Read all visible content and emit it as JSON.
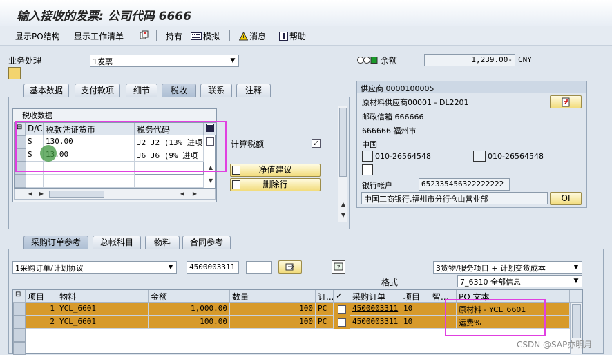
{
  "window": {
    "title": "输入接收的发票: 公司代码 6666"
  },
  "toolbar": {
    "show_po_structure": "显示PO结构",
    "show_worklist": "显示工作清单",
    "hold": "持有",
    "simulate": "模拟",
    "messages": "消息",
    "help": "帮助"
  },
  "transaction": {
    "label": "业务处理",
    "value": "1发票"
  },
  "balance": {
    "label": "余额",
    "value": "1,239.00-",
    "currency": "CNY"
  },
  "tabs": [
    "基本数据",
    "支付款项",
    "细节",
    "税收",
    "联系",
    "注释"
  ],
  "tax": {
    "section_title": "税收数据",
    "headers": [
      "D/C",
      "税款凭证货币",
      "税务代码"
    ],
    "rows": [
      {
        "dc": "S",
        "amount": "130.00",
        "code": "J2 J2 (13% 进项"
      },
      {
        "dc": "S",
        "amount": "13.00",
        "code": "J6 J6 (9% 进项"
      }
    ],
    "calc_tax_label": "计算税额",
    "calc_tax_checked": true,
    "net_proposal": "净值建议",
    "delete_row": "删除行"
  },
  "vendor": {
    "header": "供应商 0000100005",
    "name": "原材料供应商00001 - DL2201",
    "pobox": "邮政信箱 666666",
    "city": "666666 福州市",
    "country": "中国",
    "phone1": "010-26564548",
    "phone2": "010-26564548",
    "bank_label": "银行帐户",
    "bank_account": "652335456322222222",
    "bank_name": "中国工商银行,福州市分行仓山营业部",
    "oi_button": "OI"
  },
  "po_tabs": [
    "采购订单参考",
    "总帐科目",
    "物料",
    "合同参考"
  ],
  "po_ref": {
    "type": "1采购订单/计划协议",
    "po_number": "4500003311",
    "scope": "3货物/服务项目 + 计划交货成本",
    "format_label": "格式",
    "format_value": "7_6310 全部信息"
  },
  "items": {
    "headers": [
      "项目",
      "物料",
      "金额",
      "数量",
      "订...",
      "",
      "采购订单",
      "项目",
      "智...",
      "PO 文本"
    ],
    "rows": [
      {
        "item": "1",
        "material": "YCL_6601",
        "amount": "1,000.00",
        "qty": "100",
        "unit": "PC",
        "po": "4500003311",
        "po_item": "10",
        "text": "原材料 - YCL_6601"
      },
      {
        "item": "2",
        "material": "YCL_6601",
        "amount": "100.00",
        "qty": "100",
        "unit": "PC",
        "po": "4500003311",
        "po_item": "10",
        "text": "运费%"
      }
    ]
  },
  "watermark": "CSDN @SAP亦明月",
  "colors": {
    "row_highlight": "#d79a2b",
    "annotation": "#e040e0",
    "button": "#f2dc7c"
  }
}
